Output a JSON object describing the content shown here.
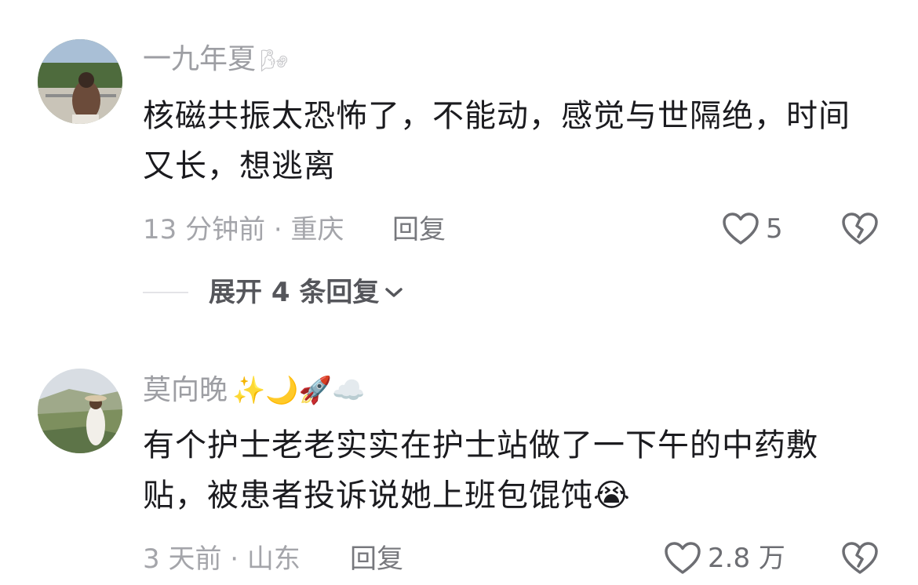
{
  "comments": [
    {
      "username": "一九年夏",
      "username_decor": "🌬",
      "text": "核磁共振太恐怖了，不能动，感觉与世隔绝，时间又长，想逃离",
      "meta": "13 分钟前 · 重庆",
      "reply_label": "回复",
      "like_count": "5",
      "expand_label": "展开 4 条回复"
    },
    {
      "username": "莫向晚",
      "username_decor": "✨🌙🚀☁️",
      "text": "有个护士老老实实在护士站做了一下午的中药敷贴，被患者投诉说她上班包馄饨😭",
      "meta": "3 天前 · 山东",
      "reply_label": "回复",
      "like_count": "2.8 万"
    }
  ],
  "icons": {
    "heart": "heart-outline-icon",
    "dislike": "broken-heart-icon",
    "chevron": "chevron-down-icon"
  },
  "colors": {
    "username": "#9d9ea3",
    "text": "#1b1b1f",
    "meta": "#a4a5aa",
    "icon": "#6d6e73"
  }
}
